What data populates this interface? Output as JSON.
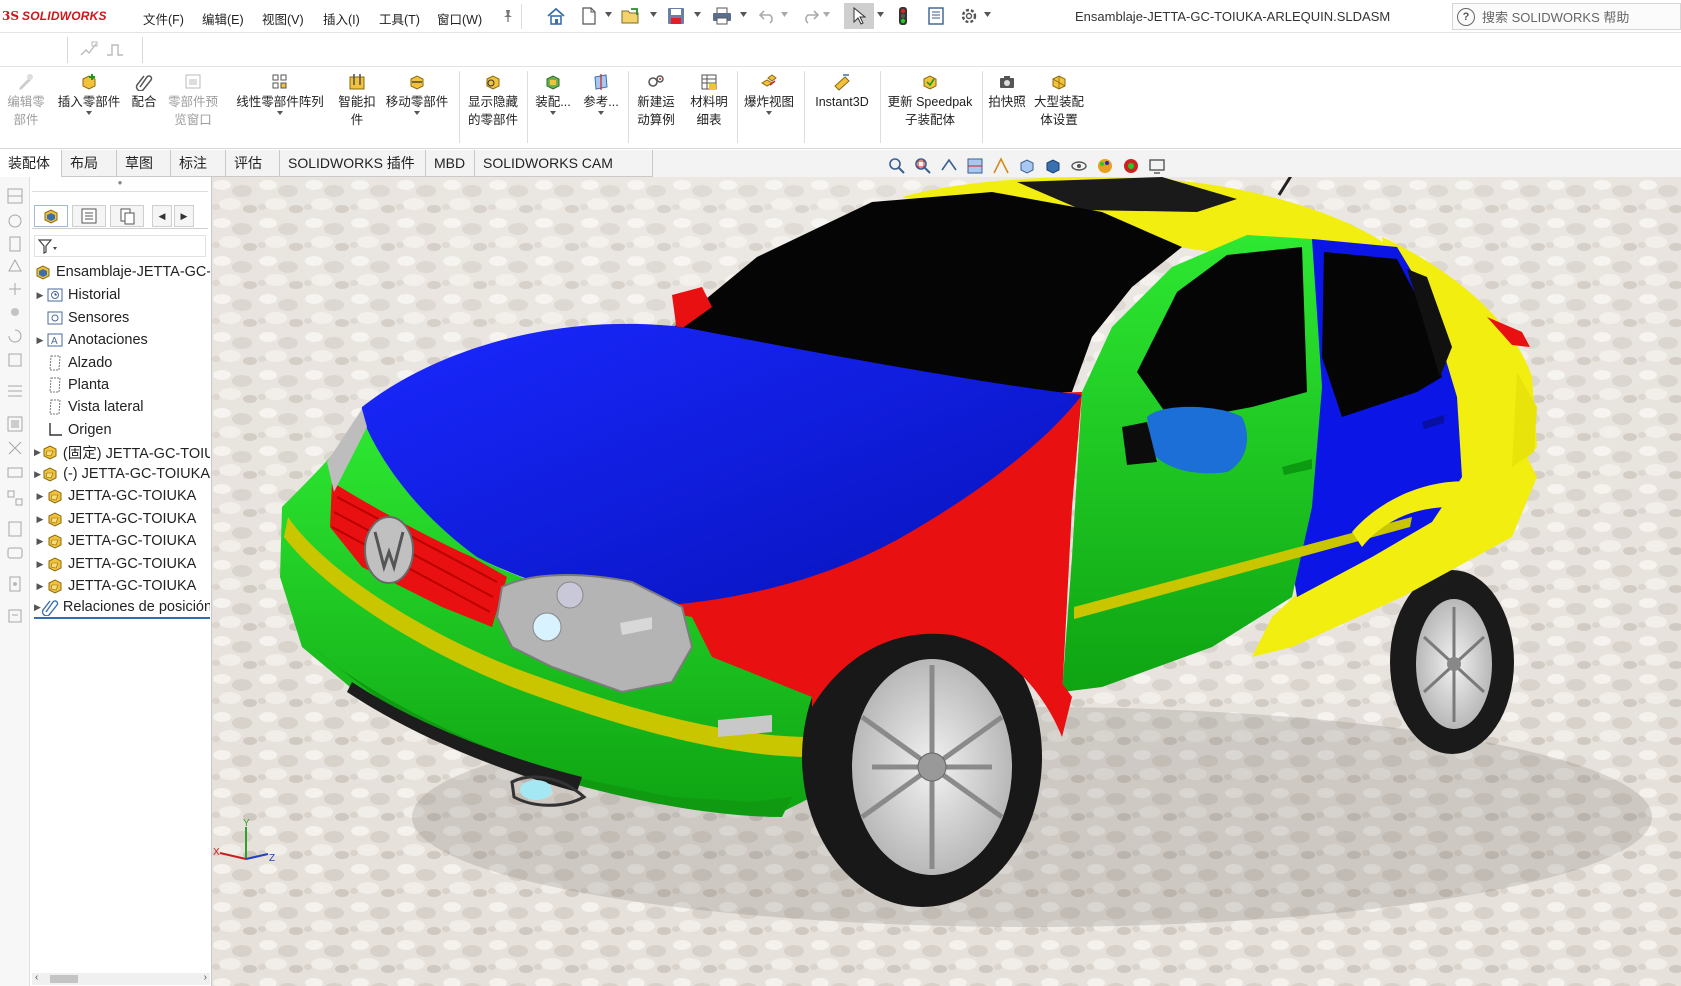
{
  "app": {
    "logo_ds": "3S",
    "logo_name": "SOLIDWORKS",
    "document_title": "Ensamblaje-JETTA-GC-TOIUKA-ARLEQUIN.SLDASM",
    "search_placeholder": "搜索 SOLIDWORKS 帮助"
  },
  "menu": [
    "文件(F)",
    "编辑(E)",
    "视图(V)",
    "插入(I)",
    "工具(T)",
    "窗口(W)"
  ],
  "commands": [
    {
      "label": "编辑零\n部件",
      "disabled": true
    },
    {
      "label": "插入零部件",
      "disabled": false
    },
    {
      "label": "配合",
      "disabled": false
    },
    {
      "label": "零部件预\n览窗口",
      "disabled": true
    },
    {
      "label": "线性零部件阵列",
      "disabled": false
    },
    {
      "label": "智能扣\n件",
      "disabled": false
    },
    {
      "label": "移动零部件",
      "disabled": false
    },
    {
      "label": "显示隐藏\n的零部件",
      "disabled": false
    },
    {
      "label": "装配...",
      "disabled": false
    },
    {
      "label": "参考...",
      "disabled": false
    },
    {
      "label": "新建运\n动算例",
      "disabled": false
    },
    {
      "label": "材料明\n细表",
      "disabled": false
    },
    {
      "label": "爆炸视图",
      "disabled": false
    },
    {
      "label": "Instant3D",
      "disabled": false
    },
    {
      "label": "更新 Speedpak\n子装配体",
      "disabled": false
    },
    {
      "label": "拍快照",
      "disabled": false
    },
    {
      "label": "大型装配\n体设置",
      "disabled": false
    }
  ],
  "tabs": [
    "装配体",
    "布局",
    "草图",
    "标注",
    "评估",
    "SOLIDWORKS 插件",
    "MBD",
    "SOLIDWORKS CAM"
  ],
  "active_tab": "装配体",
  "tree": {
    "root": "Ensamblaje-JETTA-GC-TOIUKA-ARLEQUIN",
    "items": [
      {
        "label": "Historial",
        "expandable": true,
        "icon": "history-icon"
      },
      {
        "label": "Sensores",
        "expandable": false,
        "icon": "sensor-icon"
      },
      {
        "label": "Anotaciones",
        "expandable": true,
        "icon": "annotation-icon"
      },
      {
        "label": "Alzado",
        "expandable": false,
        "icon": "plane-icon"
      },
      {
        "label": "Planta",
        "expandable": false,
        "icon": "plane-icon"
      },
      {
        "label": "Vista lateral",
        "expandable": false,
        "icon": "plane-icon"
      },
      {
        "label": "Origen",
        "expandable": false,
        "icon": "origin-icon"
      },
      {
        "label": "(固定) JETTA-GC-TOIUKA",
        "expandable": true,
        "icon": "part-icon"
      },
      {
        "label": "(-) JETTA-GC-TOIUKA",
        "expandable": true,
        "icon": "part-icon"
      },
      {
        "label": "JETTA-GC-TOIUKA",
        "expandable": true,
        "icon": "part-icon"
      },
      {
        "label": "JETTA-GC-TOIUKA",
        "expandable": true,
        "icon": "part-icon"
      },
      {
        "label": "JETTA-GC-TOIUKA",
        "expandable": true,
        "icon": "part-icon"
      },
      {
        "label": "JETTA-GC-TOIUKA",
        "expandable": true,
        "icon": "part-icon"
      },
      {
        "label": "JETTA-GC-TOIUKA",
        "expandable": true,
        "icon": "part-icon"
      },
      {
        "label": "Relaciones de posición",
        "expandable": true,
        "icon": "mates-icon"
      }
    ]
  },
  "triad": {
    "x": "X",
    "y": "Y",
    "z": "Z"
  },
  "colors": {
    "car_green": "#16d21a",
    "car_blue": "#0a15e6",
    "car_red": "#e81010",
    "car_yellow": "#f2ee10",
    "mirror_blue": "#1b6fd6",
    "window_black": "#050505"
  }
}
